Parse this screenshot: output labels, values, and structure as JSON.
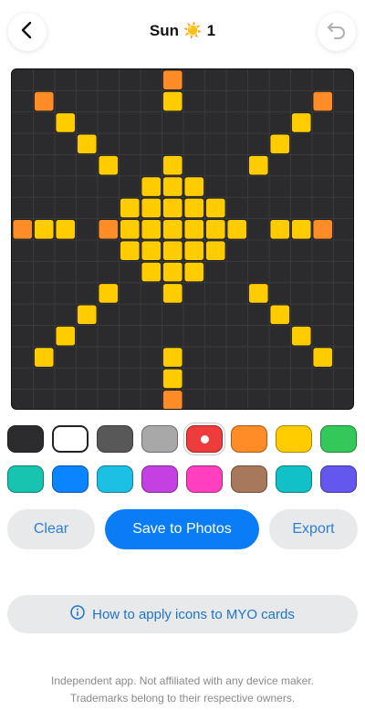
{
  "header": {
    "title": "Sun ☀️ 1"
  },
  "icons": {
    "back": "chevron-left-icon",
    "undo": "undo-arrow-icon",
    "info": "info-circle-icon"
  },
  "colors": {
    "board_bg": "#2b2b2d",
    "grid_line": "#3a3a3c",
    "yellow": "#ffcc00",
    "orange": "#ff8c26",
    "accent": "#0a7cf6"
  },
  "grid": {
    "columns": 16,
    "rows": 16,
    "yellow_cells": [
      [
        7,
        1
      ],
      [
        2,
        2
      ],
      [
        13,
        2
      ],
      [
        3,
        3
      ],
      [
        12,
        3
      ],
      [
        4,
        4
      ],
      [
        7,
        4
      ],
      [
        11,
        4
      ],
      [
        6,
        5
      ],
      [
        7,
        5
      ],
      [
        8,
        5
      ],
      [
        5,
        6
      ],
      [
        6,
        6
      ],
      [
        7,
        6
      ],
      [
        8,
        6
      ],
      [
        9,
        6
      ],
      [
        1,
        7
      ],
      [
        2,
        7
      ],
      [
        5,
        7
      ],
      [
        6,
        7
      ],
      [
        7,
        7
      ],
      [
        8,
        7
      ],
      [
        9,
        7
      ],
      [
        10,
        7
      ],
      [
        12,
        7
      ],
      [
        13,
        7
      ],
      [
        5,
        8
      ],
      [
        6,
        8
      ],
      [
        7,
        8
      ],
      [
        8,
        8
      ],
      [
        9,
        8
      ],
      [
        6,
        9
      ],
      [
        7,
        9
      ],
      [
        8,
        9
      ],
      [
        4,
        10
      ],
      [
        7,
        10
      ],
      [
        11,
        10
      ],
      [
        3,
        11
      ],
      [
        12,
        11
      ],
      [
        2,
        12
      ],
      [
        13,
        12
      ],
      [
        1,
        13
      ],
      [
        7,
        13
      ],
      [
        14,
        13
      ],
      [
        7,
        14
      ]
    ],
    "orange_cells": [
      [
        7,
        0
      ],
      [
        1,
        1
      ],
      [
        14,
        1
      ],
      [
        0,
        7
      ],
      [
        4,
        7
      ],
      [
        14,
        7
      ],
      [
        7,
        15
      ]
    ]
  },
  "palette": [
    {
      "color": "#2c2c2e",
      "selected": false
    },
    {
      "color": "#ffffff",
      "selected": false
    },
    {
      "color": "#585858",
      "selected": false
    },
    {
      "color": "#a8a8a8",
      "selected": false
    },
    {
      "color": "#ee3b3b",
      "selected": true
    },
    {
      "color": "#ff8c26",
      "selected": false
    },
    {
      "color": "#ffcc00",
      "selected": false
    },
    {
      "color": "#34c759",
      "selected": false
    },
    {
      "color": "#16c4b0",
      "selected": false
    },
    {
      "color": "#0a84ff",
      "selected": false
    },
    {
      "color": "#1cc0e4",
      "selected": false
    },
    {
      "color": "#c540e0",
      "selected": false
    },
    {
      "color": "#ff3fc0",
      "selected": false
    },
    {
      "color": "#a8785a",
      "selected": false
    },
    {
      "color": "#12c0c8",
      "selected": false
    },
    {
      "color": "#6457ee",
      "selected": false
    }
  ],
  "actions": {
    "clear": "Clear",
    "save": "Save to Photos",
    "export": "Export"
  },
  "howto": {
    "label": "How to apply icons to MYO cards"
  },
  "footer": {
    "line1": "Independent app. Not affiliated with any device maker.",
    "line2": "Trademarks belong to their respective owners."
  }
}
